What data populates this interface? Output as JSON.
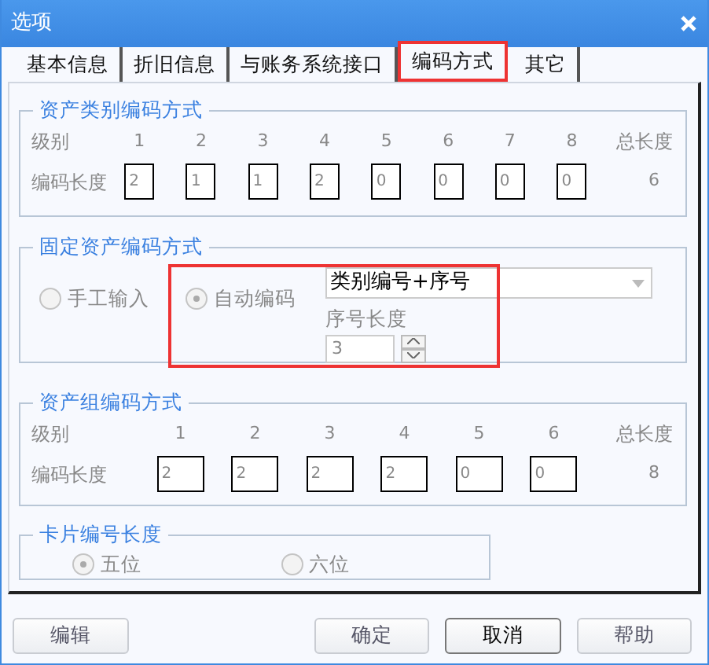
{
  "window": {
    "title": "选项"
  },
  "tabs": [
    {
      "label": "基本信息",
      "selected": false,
      "highlighted": false
    },
    {
      "label": "折旧信息",
      "selected": false,
      "highlighted": false
    },
    {
      "label": "与账务系统接口",
      "selected": false,
      "highlighted": false
    },
    {
      "label": "编码方式",
      "selected": true,
      "highlighted": true
    },
    {
      "label": "其它",
      "selected": false,
      "highlighted": false
    }
  ],
  "asset_category_coding": {
    "title": "资产类别编码方式",
    "level_label": "级别",
    "length_label": "编码长度",
    "total_label": "总长度",
    "total": "6",
    "levels": [
      {
        "level": "1",
        "length": "2"
      },
      {
        "level": "2",
        "length": "1"
      },
      {
        "level": "3",
        "length": "1"
      },
      {
        "level": "4",
        "length": "2"
      },
      {
        "level": "5",
        "length": "0"
      },
      {
        "level": "6",
        "length": "0"
      },
      {
        "level": "7",
        "length": "0"
      },
      {
        "level": "8",
        "length": "0"
      }
    ]
  },
  "fixed_asset_coding": {
    "title": "固定资产编码方式",
    "highlighted": true,
    "options": [
      {
        "label": "手工输入",
        "selected": false
      },
      {
        "label": "自动编码",
        "selected": true
      }
    ],
    "rule": {
      "value": "类别编号+序号"
    },
    "serial_length": {
      "label": "序号长度",
      "value": "3"
    }
  },
  "asset_group_coding": {
    "title": "资产组编码方式",
    "level_label": "级别",
    "length_label": "编码长度",
    "total_label": "总长度",
    "total": "8",
    "levels": [
      {
        "level": "1",
        "length": "2"
      },
      {
        "level": "2",
        "length": "2"
      },
      {
        "level": "3",
        "length": "2"
      },
      {
        "level": "4",
        "length": "2"
      },
      {
        "level": "5",
        "length": "0"
      },
      {
        "level": "6",
        "length": "0"
      }
    ]
  },
  "card_number_length": {
    "title": "卡片编号长度",
    "options": [
      {
        "label": "五位",
        "selected": true
      },
      {
        "label": "六位",
        "selected": false
      }
    ]
  },
  "buttons": [
    {
      "label": "编辑",
      "default": false
    },
    {
      "label": "确定",
      "default": false
    },
    {
      "label": "取消",
      "default": true
    },
    {
      "label": "帮助",
      "default": false
    }
  ]
}
